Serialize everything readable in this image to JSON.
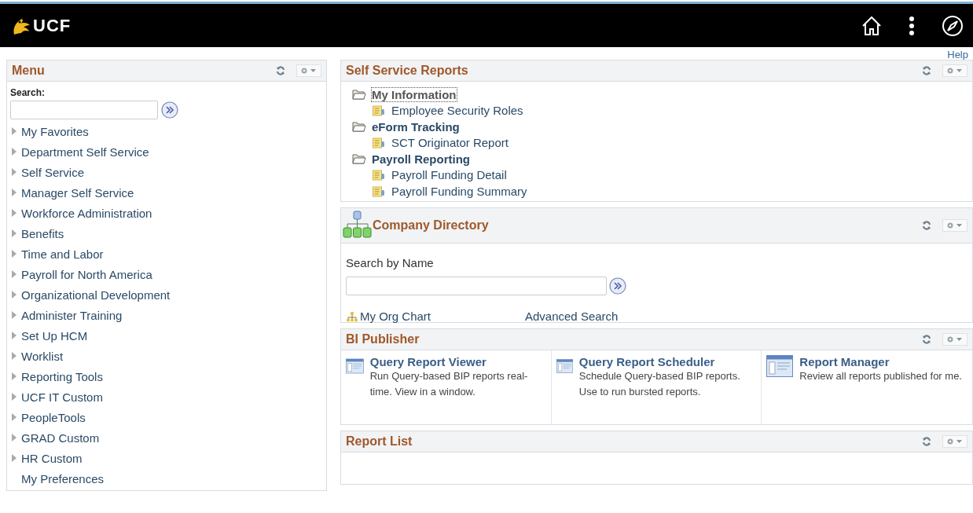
{
  "header": {
    "logo_text": "UCF"
  },
  "help_link": "Help",
  "menu": {
    "title": "Menu",
    "search_label": "Search:",
    "items": [
      {
        "label": "My Favorites",
        "kind": "folder"
      },
      {
        "label": "Department Self Service",
        "kind": "folder"
      },
      {
        "label": "Self Service",
        "kind": "folder"
      },
      {
        "label": "Manager Self Service",
        "kind": "folder"
      },
      {
        "label": "Workforce Administration",
        "kind": "folder"
      },
      {
        "label": "Benefits",
        "kind": "folder"
      },
      {
        "label": "Time and Labor",
        "kind": "folder"
      },
      {
        "label": "Payroll for North America",
        "kind": "folder"
      },
      {
        "label": "Organizational Development",
        "kind": "folder"
      },
      {
        "label": "Administer Training",
        "kind": "folder"
      },
      {
        "label": "Set Up HCM",
        "kind": "folder"
      },
      {
        "label": "Worklist",
        "kind": "folder"
      },
      {
        "label": "Reporting Tools",
        "kind": "folder"
      },
      {
        "label": "UCF IT Custom",
        "kind": "folder"
      },
      {
        "label": "PeopleTools",
        "kind": "folder"
      },
      {
        "label": "GRAD Custom",
        "kind": "folder"
      },
      {
        "label": "HR Custom",
        "kind": "folder"
      },
      {
        "label": "My Preferences",
        "kind": "link"
      }
    ]
  },
  "self_service_reports": {
    "title": "Self Service Reports",
    "folders": [
      {
        "label": "My Information",
        "focused": true,
        "children": [
          {
            "label": "Employee Security Roles"
          }
        ]
      },
      {
        "label": "eForm Tracking",
        "focused": false,
        "children": [
          {
            "label": "SCT Originator Report"
          }
        ]
      },
      {
        "label": "Payroll Reporting",
        "focused": false,
        "children": [
          {
            "label": "Payroll Funding Detail"
          },
          {
            "label": "Payroll Funding Summary"
          }
        ]
      }
    ]
  },
  "company_directory": {
    "title": "Company Directory",
    "search_label": "Search by Name",
    "org_chart_link": "My Org Chart",
    "advanced_search_link": "Advanced Search"
  },
  "bi_publisher": {
    "title": "BI Publisher",
    "items": [
      {
        "title": "Query Report Viewer",
        "description": "Run Query-based BIP reports real-time. View in a window."
      },
      {
        "title": "Query Report Scheduler",
        "description": "Schedule Query-based BIP reports. Use to run bursted reports."
      },
      {
        "title": "Report Manager",
        "description": "Review all reports published for me."
      }
    ]
  },
  "report_list": {
    "title": "Report List"
  }
}
